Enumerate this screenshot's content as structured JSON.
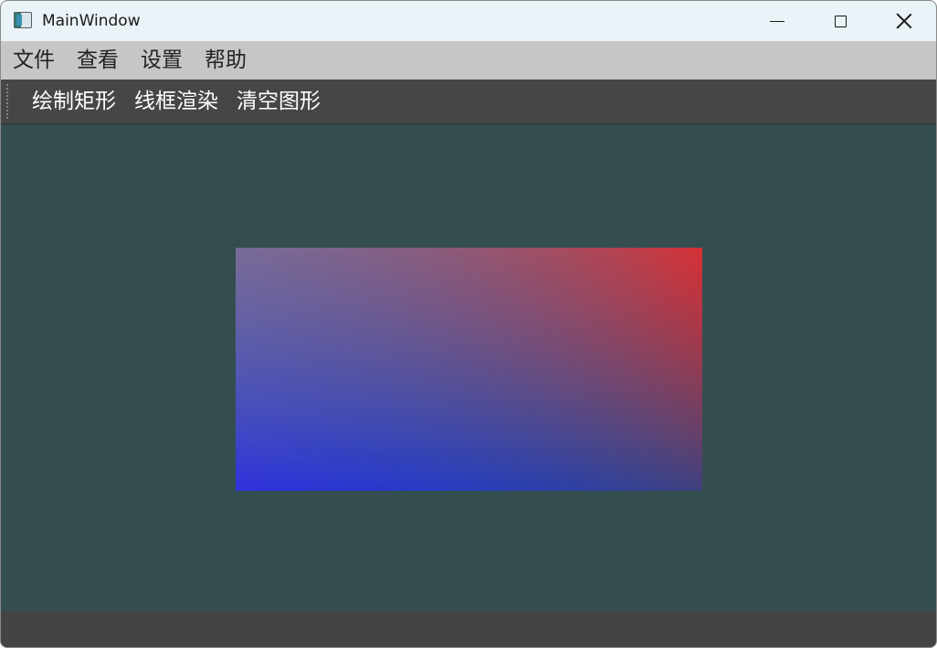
{
  "window": {
    "title": "MainWindow"
  },
  "menubar": {
    "items": [
      "文件",
      "查看",
      "设置",
      "帮助"
    ]
  },
  "toolbar": {
    "actions": [
      "绘制矩形",
      "线框渲染",
      "清空图形"
    ]
  },
  "canvas": {
    "background": "#344e4f",
    "shape": "rectangle",
    "corner_colors": {
      "top_right": "#ff0000",
      "bottom_left": "#0000ff",
      "bottom_right": "#00ff00",
      "top_left": "#7f7f7f"
    }
  },
  "icons": [
    "app-icon",
    "minimize-icon",
    "maximize-icon",
    "close-icon"
  ]
}
